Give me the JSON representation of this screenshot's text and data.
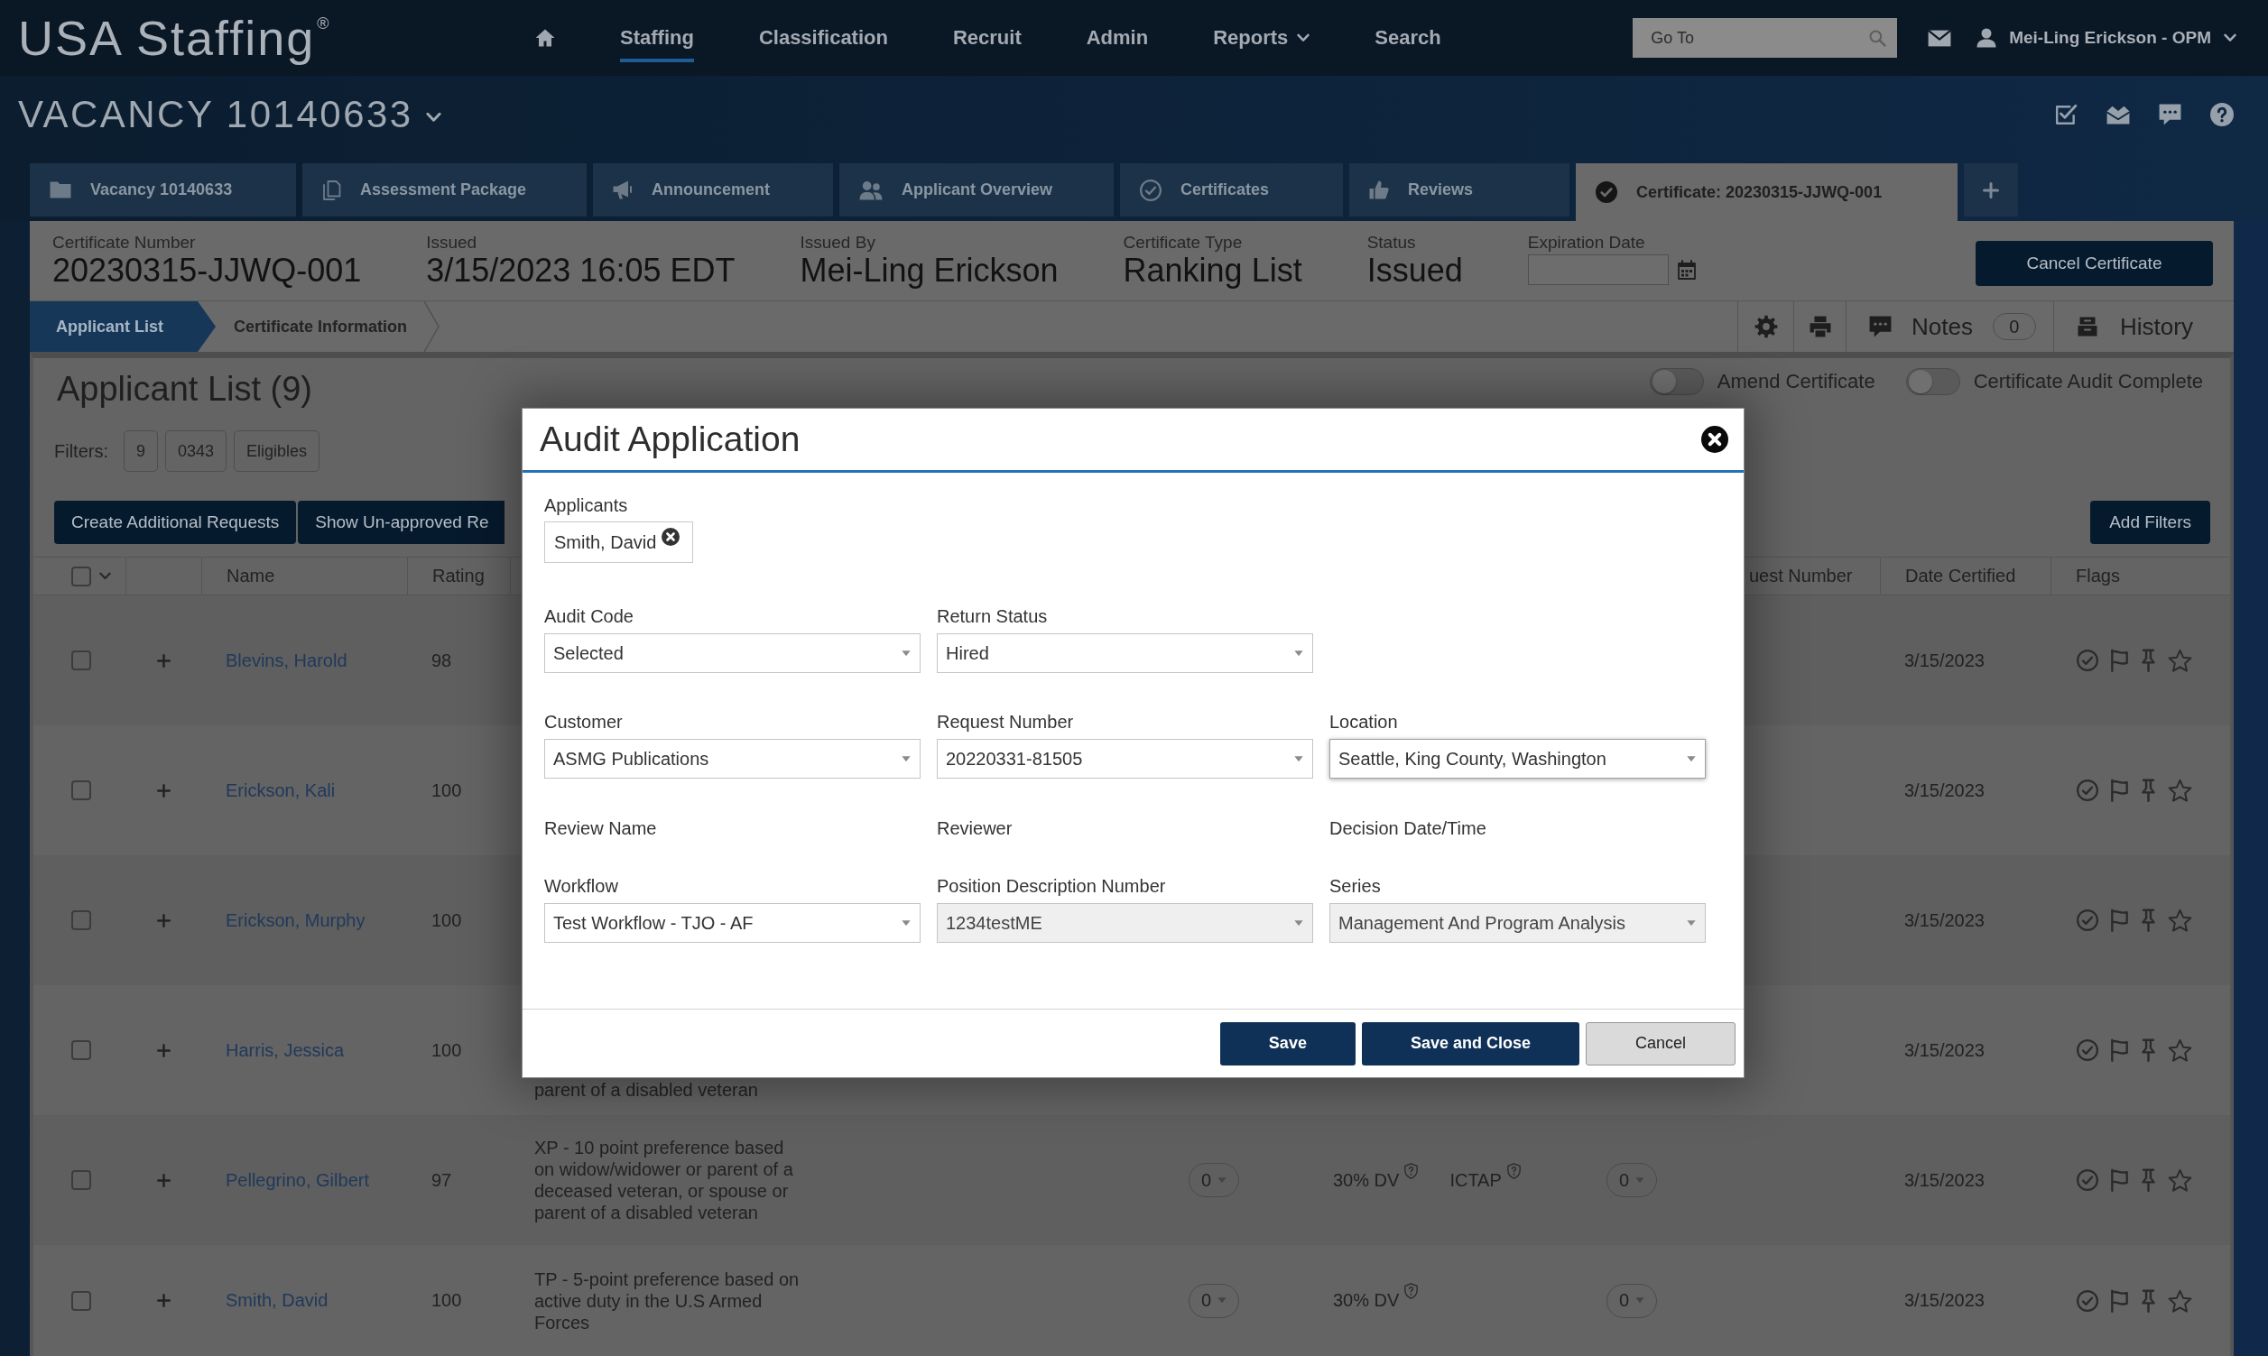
{
  "top_nav": {
    "logo": "USA Staffing$^{®}$",
    "items": [
      {
        "label": "Staffing",
        "selected": true,
        "has_menu": false
      },
      {
        "label": "Classification",
        "selected": false,
        "has_menu": false
      },
      {
        "label": "Recruit",
        "selected": false,
        "has_menu": false
      },
      {
        "label": "Admin",
        "selected": false,
        "has_menu": false
      },
      {
        "label": "Reports",
        "selected": false,
        "has_menu": true
      },
      {
        "label": "Search",
        "selected": false,
        "has_menu": false
      }
    ],
    "go_to": {
      "placeholder": "Go To"
    },
    "user": {
      "name": "Mei-Ling Erickson - OPM"
    }
  },
  "vacancy": {
    "title": "VACANCY 10140633"
  },
  "tabs": [
    {
      "label": "Vacancy 10140633",
      "selected": false
    },
    {
      "label": "Assessment Package",
      "selected": false
    },
    {
      "label": "Announcement",
      "selected": false
    },
    {
      "label": "Applicant Overview",
      "selected": false
    },
    {
      "label": "Certificates",
      "selected": false
    },
    {
      "label": "Reviews",
      "selected": false
    },
    {
      "label": "Certificate: 20230315-JJWQ-001",
      "selected": true
    }
  ],
  "certificate": {
    "fields": [
      {
        "label": "Certificate Number",
        "value": "20230315-JJWQ-001"
      },
      {
        "label": "Issued",
        "value": "3/15/2023 16:05 EDT"
      },
      {
        "label": "Issued By",
        "value": "Mei-Ling Erickson"
      },
      {
        "label": "Certificate Type",
        "value": "Ranking List"
      },
      {
        "label": "Status",
        "value": "Issued"
      }
    ],
    "expiration_date": {
      "label": "Expiration Date"
    },
    "cancel_button": "Cancel Certificate"
  },
  "subnav": {
    "steps": [
      {
        "label": "Applicant List",
        "selected": true
      },
      {
        "label": "Certificate Information",
        "selected": false
      }
    ],
    "notes": {
      "label": "Notes",
      "count": "0"
    },
    "history": {
      "label": "History"
    }
  },
  "applicant_list": {
    "title": "Applicant List (9)",
    "toggles": [
      {
        "label": "Amend Certificate",
        "on": false
      },
      {
        "label": "Certificate Audit Complete",
        "on": false
      }
    ],
    "filters": {
      "label": "Filters:",
      "chips": [
        "9",
        "0343",
        "Eligibles"
      ]
    },
    "actions": [
      "Create Additional Requests",
      "Show Un-approved Re"
    ],
    "add_filters": "Add Filters"
  },
  "table": {
    "select_all": {
      "checked": false
    },
    "columns": {
      "name": "Name",
      "rating": "Rating",
      "column_9": "uest Number",
      "date_certified": "Date Certified",
      "flags": "Flags"
    },
    "rows": [
      {
        "checked": false,
        "name": "Blevins, Harold",
        "rating": "98",
        "date_certified": "3/15/2023"
      },
      {
        "checked": false,
        "name": "Erickson, Kali",
        "rating": "100",
        "date_certified": "3/15/2023"
      },
      {
        "checked": false,
        "name": "Erickson, Murphy",
        "rating": "100",
        "date_certified": "3/15/2023"
      },
      {
        "checked": false,
        "name": "Harris, Jessica",
        "rating": "100",
        "column_5": "parent of a disabled veteran",
        "date_certified": "3/15/2023"
      },
      {
        "checked": false,
        "name": "Pellegrino, Gilbert",
        "rating": "97",
        "column_5": "XP - 10 point preference based on widow/widower or parent of a deceased veteran, or spouse or parent of a disabled veteran",
        "column_6": "0",
        "column_7": [
          "30% DV",
          "ICTAP"
        ],
        "column_8": "0",
        "date_certified": "3/15/2023"
      },
      {
        "checked": false,
        "name": "Smith, David",
        "rating": "100",
        "column_5": "TP - 5-point preference based on active duty in the U.S Armed Forces",
        "column_6": "0",
        "column_7": [
          "30% DV"
        ],
        "column_8": "0",
        "date_certified": "3/15/2023"
      }
    ]
  },
  "dialog": {
    "title": "Audit Application",
    "applicants": {
      "label": "Applicants",
      "chips": [
        "Smith, David"
      ]
    },
    "rows": [
      [
        {
          "kind": "select",
          "label": "Audit Code",
          "value": "Selected",
          "disabled": false,
          "focused": false
        },
        {
          "kind": "select",
          "label": "Return Status",
          "value": "Hired",
          "disabled": false,
          "focused": false
        }
      ],
      [
        {
          "kind": "select",
          "label": "Customer",
          "value": "ASMG Publications",
          "disabled": false,
          "focused": false
        },
        {
          "kind": "select",
          "label": "Request Number",
          "value": "20220331-81505",
          "disabled": false,
          "focused": false
        },
        {
          "kind": "select",
          "label": "Location",
          "value": "Seattle, King County, Washington",
          "disabled": false,
          "focused": true
        }
      ],
      [
        {
          "kind": "text",
          "label": "Review Name"
        },
        {
          "kind": "text",
          "label": "Reviewer"
        },
        {
          "kind": "text",
          "label": "Decision Date/Time"
        }
      ],
      [
        {
          "kind": "select",
          "label": "Workflow",
          "value": "Test Workflow - TJO - AF",
          "disabled": false,
          "focused": false
        },
        {
          "kind": "select",
          "label": "Position Description Number",
          "value": "1234testME",
          "disabled": true,
          "focused": false
        },
        {
          "kind": "select",
          "label": "Series",
          "value": "Management And Program Analysis",
          "disabled": true,
          "focused": false
        }
      ]
    ],
    "buttons": [
      {
        "label": "Save",
        "kind": "primary"
      },
      {
        "label": "Save and Close",
        "kind": "primary"
      },
      {
        "label": "Cancel",
        "kind": "secondary"
      }
    ]
  }
}
